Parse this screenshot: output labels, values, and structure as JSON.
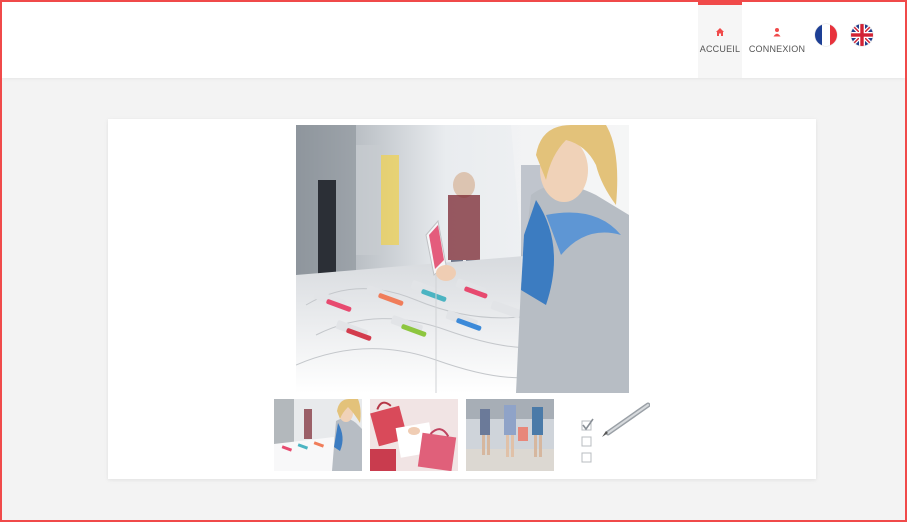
{
  "nav": {
    "home_label": "ACCUEIL",
    "login_label": "CONNEXION",
    "home_icon": "home-icon",
    "login_icon": "user-icon",
    "accent_color": "#f04a4a"
  },
  "languages": [
    {
      "code": "fr",
      "icon": "french-flag-icon"
    },
    {
      "code": "en",
      "icon": "uk-flag-icon"
    }
  ],
  "gallery": {
    "main_image": "woman-trying-phone-in-store-photo",
    "thumbnails": [
      "woman-phone-store-thumbnail",
      "shopping-bags-thumbnail",
      "shoppers-legs-thumbnail",
      "checklist-pen-thumbnail"
    ]
  }
}
